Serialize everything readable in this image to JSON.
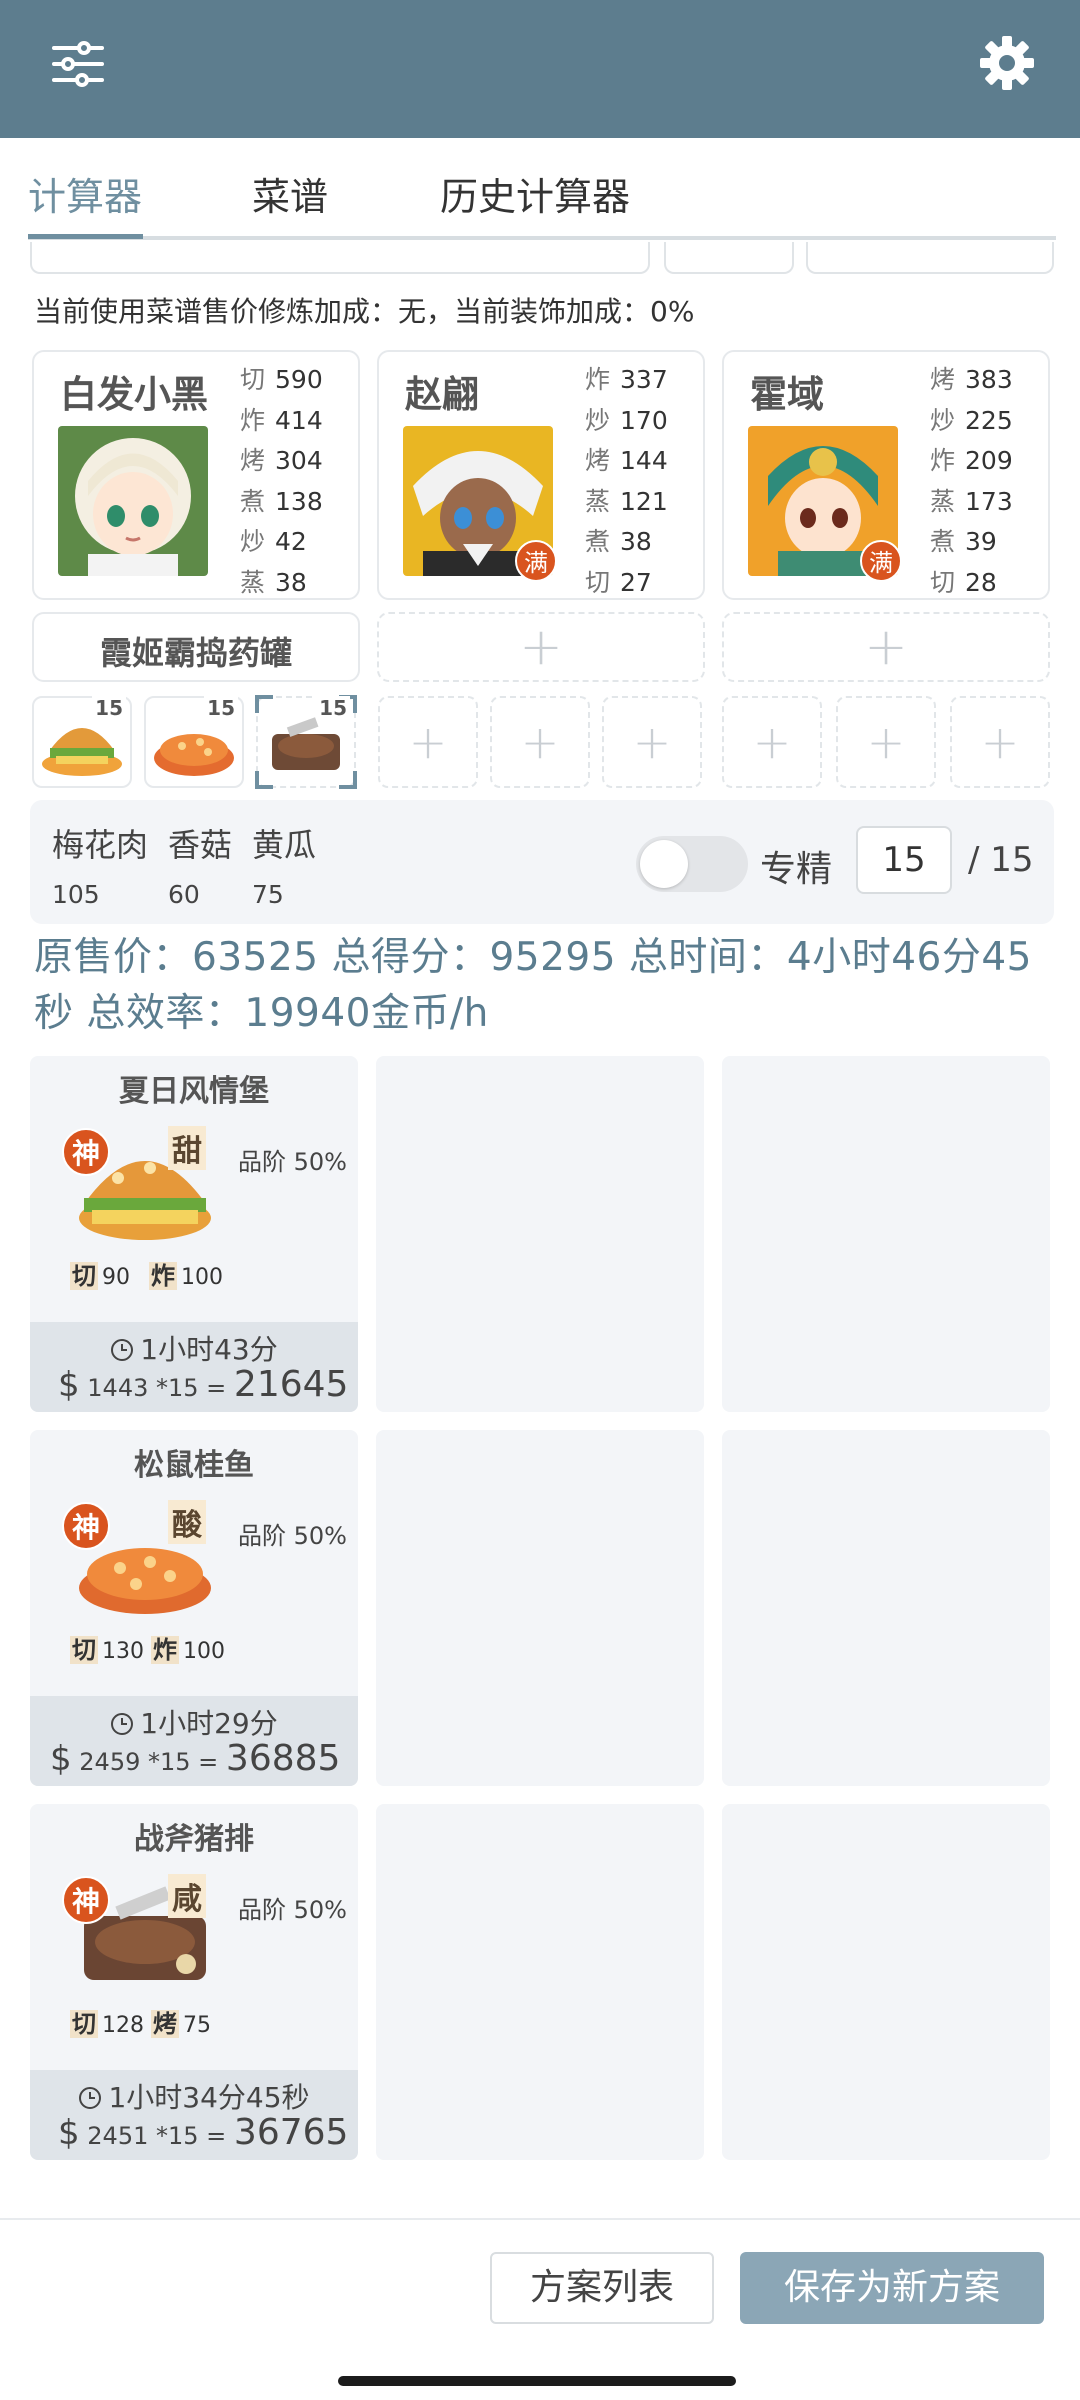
{
  "colors": {
    "header": "#5d7d8e",
    "accent": "#6f8fa0",
    "summary_text": "#5b7d8f",
    "badge": "#d9541e",
    "save_button": "#8ba6b6"
  },
  "header": {
    "menu_icon": "sliders-icon",
    "settings_icon": "gear-icon"
  },
  "tabs": [
    {
      "label": "计算器",
      "active": true
    },
    {
      "label": "菜谱",
      "active": false
    },
    {
      "label": "历史计算器",
      "active": false
    }
  ],
  "bonus_line": "当前使用菜谱售价修炼加成：无，当前装饰加成：0%",
  "chefs": [
    {
      "name": "白发小黑",
      "badge": "",
      "skills": [
        {
          "k": "切",
          "v": "590"
        },
        {
          "k": "炸",
          "v": "414"
        },
        {
          "k": "烤",
          "v": "304"
        },
        {
          "k": "煮",
          "v": "138"
        },
        {
          "k": "炒",
          "v": "42"
        },
        {
          "k": "蒸",
          "v": "38"
        }
      ]
    },
    {
      "name": "赵翩",
      "badge": "满",
      "skills": [
        {
          "k": "炸",
          "v": "337"
        },
        {
          "k": "炒",
          "v": "170"
        },
        {
          "k": "烤",
          "v": "144"
        },
        {
          "k": "蒸",
          "v": "121"
        },
        {
          "k": "煮",
          "v": "38"
        },
        {
          "k": "切",
          "v": "27"
        }
      ]
    },
    {
      "name": "霍域",
      "badge": "满",
      "skills": [
        {
          "k": "烤",
          "v": "383"
        },
        {
          "k": "炒",
          "v": "225"
        },
        {
          "k": "炸",
          "v": "209"
        },
        {
          "k": "蒸",
          "v": "173"
        },
        {
          "k": "煮",
          "v": "39"
        },
        {
          "k": "切",
          "v": "28"
        }
      ]
    }
  ],
  "equipment": {
    "slot1": "霞姬霸捣药罐",
    "plus": "+"
  },
  "recipe_slots": {
    "lvl1": "15",
    "lvl2": "15",
    "lvl3": "15"
  },
  "ingredients": [
    {
      "name": "梅花肉",
      "qty": "105"
    },
    {
      "name": "香菇",
      "qty": "60"
    },
    {
      "name": "黄瓜",
      "qty": "75"
    }
  ],
  "specialize": {
    "label": "专精",
    "enabled": false,
    "value": "15",
    "max": "/ 15"
  },
  "summary": "原售价：63525 总得分：95295 总时间：4小时46分45秒 总效率：19940金币/h",
  "dishes": [
    {
      "name": "夏日风情堡",
      "god": "神",
      "flavor": "甜",
      "grade": "品阶 50%",
      "s1k": "切",
      "s1v": "90",
      "s2k": "炸",
      "s2v": "100",
      "time": "1小时43分",
      "price": "1443 *15",
      "total": "21645"
    },
    {
      "name": "松鼠桂鱼",
      "god": "神",
      "flavor": "酸",
      "grade": "品阶 50%",
      "s1k": "切",
      "s1v": "130",
      "s2k": "炸",
      "s2v": "100",
      "time": "1小时29分",
      "price": "2459 *15",
      "total": "36885"
    },
    {
      "name": "战斧猪排",
      "god": "神",
      "flavor": "咸",
      "grade": "品阶 50%",
      "s1k": "切",
      "s1v": "128",
      "s2k": "烤",
      "s2v": "75",
      "time": "1小时34分45秒",
      "price": "2451 *15",
      "total": "36765"
    }
  ],
  "bottom": {
    "list_button": "方案列表",
    "save_button": "保存为新方案"
  },
  "currency_symbol": "$",
  "equals": "="
}
